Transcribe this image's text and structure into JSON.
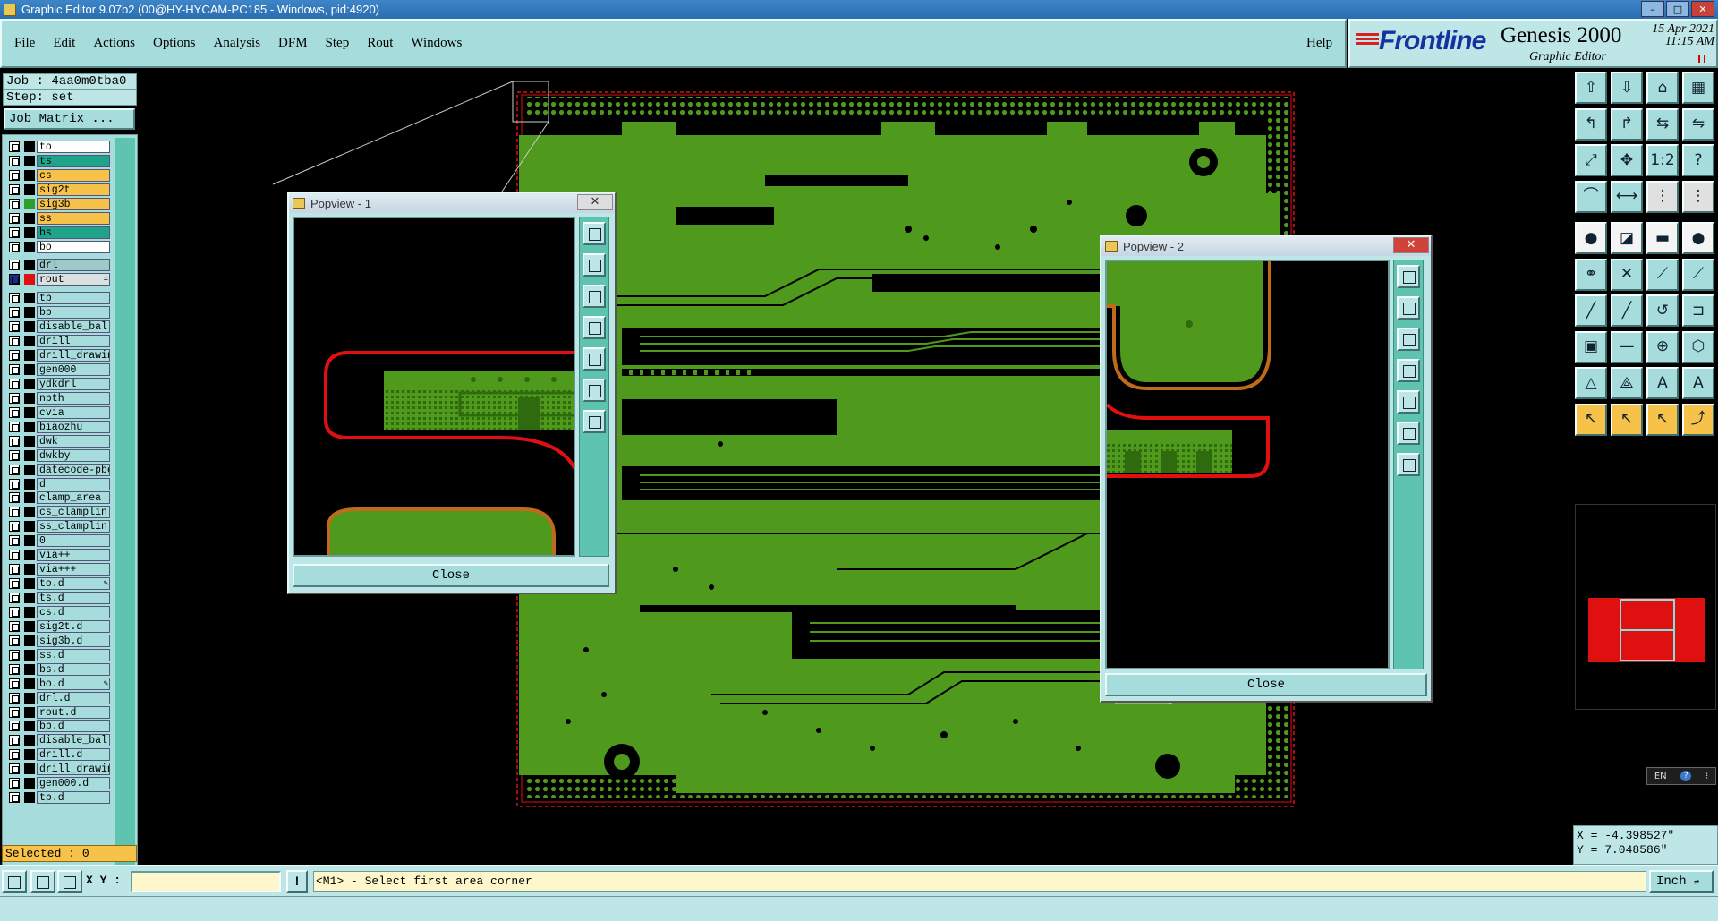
{
  "window": {
    "title": "Graphic Editor 9.07b2 (00@HY-HYCAM-PC185 - Windows, pid:4920)"
  },
  "menu": {
    "items": [
      "File",
      "Edit",
      "Actions",
      "Options",
      "Analysis",
      "DFM",
      "Step",
      "Rout",
      "Windows"
    ],
    "help": "Help"
  },
  "brand": {
    "logo": "Frontline",
    "product": "Genesis 2000",
    "subtitle": "Graphic Editor",
    "date": "15 Apr 2021",
    "time": "11:15 AM"
  },
  "job": {
    "job": "Job : 4aa0m0tba0",
    "step": "Step: set",
    "matrix_button": "Job Matrix ..."
  },
  "layers": [
    {
      "name": "to",
      "color": "#ffffff",
      "mark": ""
    },
    {
      "name": "ts",
      "color": "#1fa38a",
      "mark": ""
    },
    {
      "name": "cs",
      "color": "#f6c24a",
      "mark": ""
    },
    {
      "name": "sig2t",
      "color": "#f6c24a",
      "mark": ""
    },
    {
      "name": "sig3b",
      "color": "#f6c24a",
      "mark": "",
      "active": true
    },
    {
      "name": "ss",
      "color": "#f6c24a",
      "mark": ""
    },
    {
      "name": "bs",
      "color": "#1fa38a",
      "mark": ""
    },
    {
      "name": "bo",
      "color": "#ffffff",
      "mark": ""
    },
    {
      "name": "drl",
      "color": "#9ec9c9",
      "mark": ""
    },
    {
      "name": "rout",
      "color": "#d8e0e0",
      "mark": "=",
      "affected": true
    },
    {
      "name": "tp",
      "color": "#a7dcdc",
      "mark": ""
    },
    {
      "name": "bp",
      "color": "#a7dcdc",
      "mark": ""
    },
    {
      "name": "disable_bal",
      "color": "#a7dcdc",
      "mark": ""
    },
    {
      "name": "drill",
      "color": "#a7dcdc",
      "mark": ""
    },
    {
      "name": "drill_drawin",
      "color": "#a7dcdc",
      "mark": ""
    },
    {
      "name": "gen000",
      "color": "#a7dcdc",
      "mark": ""
    },
    {
      "name": "ydkdrl",
      "color": "#a7dcdc",
      "mark": ""
    },
    {
      "name": "npth",
      "color": "#a7dcdc",
      "mark": ""
    },
    {
      "name": "cvia",
      "color": "#a7dcdc",
      "mark": ""
    },
    {
      "name": "biaozhu",
      "color": "#a7dcdc",
      "mark": ""
    },
    {
      "name": "dwk",
      "color": "#a7dcdc",
      "mark": ""
    },
    {
      "name": "dwkby",
      "color": "#a7dcdc",
      "mark": ""
    },
    {
      "name": "datecode-pbe",
      "color": "#a7dcdc",
      "mark": ""
    },
    {
      "name": "d",
      "color": "#a7dcdc",
      "mark": ""
    },
    {
      "name": "clamp_area",
      "color": "#a7dcdc",
      "mark": ""
    },
    {
      "name": "cs_clamplin",
      "color": "#a7dcdc",
      "mark": ""
    },
    {
      "name": "ss_clamplin",
      "color": "#a7dcdc",
      "mark": ""
    },
    {
      "name": "0",
      "color": "#a7dcdc",
      "mark": ""
    },
    {
      "name": "via++",
      "color": "#a7dcdc",
      "mark": ""
    },
    {
      "name": "via+++",
      "color": "#a7dcdc",
      "mark": ""
    },
    {
      "name": "to.d",
      "color": "#a7dcdc",
      "mark": "✎"
    },
    {
      "name": "ts.d",
      "color": "#a7dcdc",
      "mark": ""
    },
    {
      "name": "cs.d",
      "color": "#a7dcdc",
      "mark": ""
    },
    {
      "name": "sig2t.d",
      "color": "#a7dcdc",
      "mark": ""
    },
    {
      "name": "sig3b.d",
      "color": "#a7dcdc",
      "mark": ""
    },
    {
      "name": "ss.d",
      "color": "#a7dcdc",
      "mark": ""
    },
    {
      "name": "bs.d",
      "color": "#a7dcdc",
      "mark": ""
    },
    {
      "name": "bo.d",
      "color": "#a7dcdc",
      "mark": "✎"
    },
    {
      "name": "drl.d",
      "color": "#a7dcdc",
      "mark": ""
    },
    {
      "name": "rout.d",
      "color": "#a7dcdc",
      "mark": ""
    },
    {
      "name": "bp.d",
      "color": "#a7dcdc",
      "mark": ""
    },
    {
      "name": "disable_bal",
      "color": "#a7dcdc",
      "mark": ""
    },
    {
      "name": "drill.d",
      "color": "#a7dcdc",
      "mark": ""
    },
    {
      "name": "drill_drawin",
      "color": "#a7dcdc",
      "mark": ""
    },
    {
      "name": "gen000.d",
      "color": "#a7dcdc",
      "mark": ""
    },
    {
      "name": "tp.d",
      "color": "#a7dcdc",
      "mark": ""
    }
  ],
  "selected": "Selected : 0",
  "popviews": [
    {
      "title": "Popview - 1",
      "close": "Close"
    },
    {
      "title": "Popview - 2",
      "close": "Close"
    }
  ],
  "coords": {
    "x": "X = -4.398527\"",
    "y": "Y = 7.048586\""
  },
  "bottom": {
    "xy_label": "X Y :",
    "xy_value": "",
    "prompt": "<M1> - Select first area corner",
    "units": "Inch"
  },
  "ime": {
    "lang": "EN"
  },
  "colors": {
    "board": "#4f9a1c",
    "board_dark": "#2f6a0e",
    "rout": "#e01010",
    "panel": "#a7dcdc",
    "accent": "#f6c24a"
  }
}
